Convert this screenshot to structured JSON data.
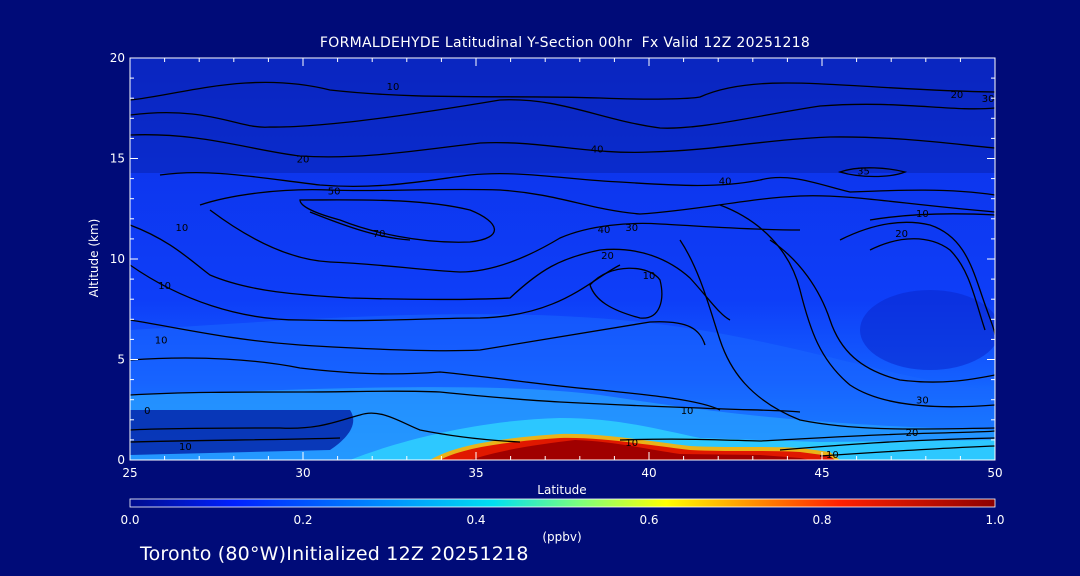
{
  "title": "FORMALDEHYDE Latitudinal Y-Section 00hr  Fx Valid 12Z 20251218",
  "footer": "Toronto (80°W)Initialized 12Z 20251218",
  "chart_data": {
    "type": "heatmap",
    "title": "FORMALDEHYDE Latitudinal Y-Section 00hr  Fx Valid 12Z 20251218",
    "xlabel": "Latitude",
    "ylabel": "Altitude (km)",
    "xlim": [
      25,
      50
    ],
    "ylim": [
      0,
      20
    ],
    "x_ticks": [
      "25",
      "30",
      "35",
      "40",
      "45",
      "50"
    ],
    "y_ticks": [
      "0",
      "5",
      "10",
      "15",
      "20"
    ],
    "colorbar": {
      "label": "(ppbv)",
      "range": [
        0.0,
        1.0
      ],
      "ticks": [
        "0.0",
        "0.2",
        "0.4",
        "0.6",
        "0.8",
        "1.0"
      ]
    },
    "high_concentration_regions": [
      {
        "lat": [
          34,
          43
        ],
        "alt": [
          0,
          1.2
        ],
        "value": 1.0
      },
      {
        "lat": [
          43,
          46
        ],
        "alt": [
          0,
          0.6
        ],
        "value": 0.9
      }
    ],
    "contour_labels": [
      {
        "text": "10",
        "lat": 32.6,
        "alt": 18.6
      },
      {
        "text": "20",
        "lat": 30.0,
        "alt": 15.0
      },
      {
        "text": "40",
        "lat": 38.5,
        "alt": 15.5
      },
      {
        "text": "50",
        "lat": 30.9,
        "alt": 13.4
      },
      {
        "text": "40",
        "lat": 42.2,
        "alt": 13.9
      },
      {
        "text": "35",
        "lat": 46.2,
        "alt": 14.4
      },
      {
        "text": "10",
        "lat": 26.5,
        "alt": 11.6
      },
      {
        "text": "70",
        "lat": 32.2,
        "alt": 11.3
      },
      {
        "text": "40",
        "lat": 38.7,
        "alt": 11.5
      },
      {
        "text": "30",
        "lat": 39.5,
        "alt": 11.6
      },
      {
        "text": "20",
        "lat": 38.8,
        "alt": 10.2
      },
      {
        "text": "10",
        "lat": 40.0,
        "alt": 9.2
      },
      {
        "text": "10",
        "lat": 47.9,
        "alt": 12.3
      },
      {
        "text": "20",
        "lat": 47.3,
        "alt": 11.3
      },
      {
        "text": "10",
        "lat": 26.0,
        "alt": 8.7
      },
      {
        "text": "10",
        "lat": 25.9,
        "alt": 6.0
      },
      {
        "text": "0",
        "lat": 25.5,
        "alt": 2.5
      },
      {
        "text": "10",
        "lat": 26.6,
        "alt": 0.7
      },
      {
        "text": "10",
        "lat": 41.1,
        "alt": 2.5
      },
      {
        "text": "10",
        "lat": 39.5,
        "alt": 0.9
      },
      {
        "text": "20",
        "lat": 47.6,
        "alt": 1.4
      },
      {
        "text": "30",
        "lat": 47.9,
        "alt": 3.0
      },
      {
        "text": "10",
        "lat": 45.3,
        "alt": 0.3
      },
      {
        "text": "20",
        "lat": 48.9,
        "alt": 18.2
      },
      {
        "text": "30",
        "lat": 49.8,
        "alt": 18.0
      }
    ]
  },
  "colors": {
    "background": "#000b78",
    "contour": "#000000"
  }
}
